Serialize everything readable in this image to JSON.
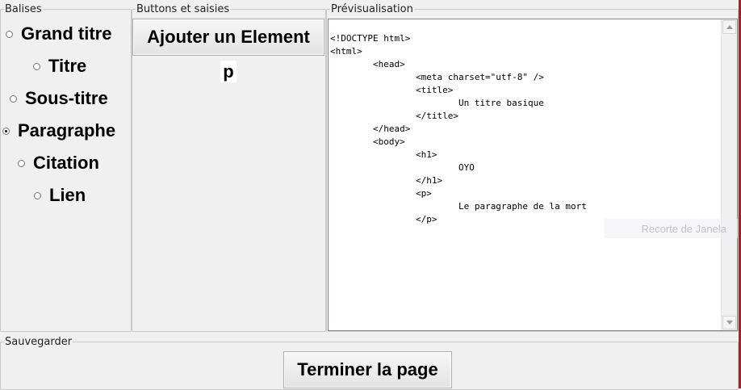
{
  "groups": {
    "balises": "Balises",
    "buttons": "Buttons et saisies",
    "preview": "Prévisualisation",
    "save": "Sauvegarder"
  },
  "radios": [
    {
      "label": "Grand titre",
      "checked": false
    },
    {
      "label": "Titre",
      "checked": false
    },
    {
      "label": "Sous-titre",
      "checked": false
    },
    {
      "label": "Paragraphe",
      "checked": true
    },
    {
      "label": "Citation",
      "checked": false
    },
    {
      "label": "Lien",
      "checked": false
    }
  ],
  "buttons": {
    "add_label": "Ajouter un Element",
    "finish_label": "Terminer la page"
  },
  "input": {
    "value": "p"
  },
  "preview": {
    "code": "<!DOCTYPE html>\n<html>\n\t<head>\n\t\t<meta charset=\"utf-8\" />\n\t\t<title>\n\t\t\tUn titre basique\n\t\t</title>\n\t</head>\n\t<body>\n\t\t<h1>\n\t\t\tOYO\n\t\t</h1>\n\t\t<p>\n\t\t\tLe paragraphe de la mort\n\t\t</p>"
  },
  "watermark": "Recorte de Janela"
}
